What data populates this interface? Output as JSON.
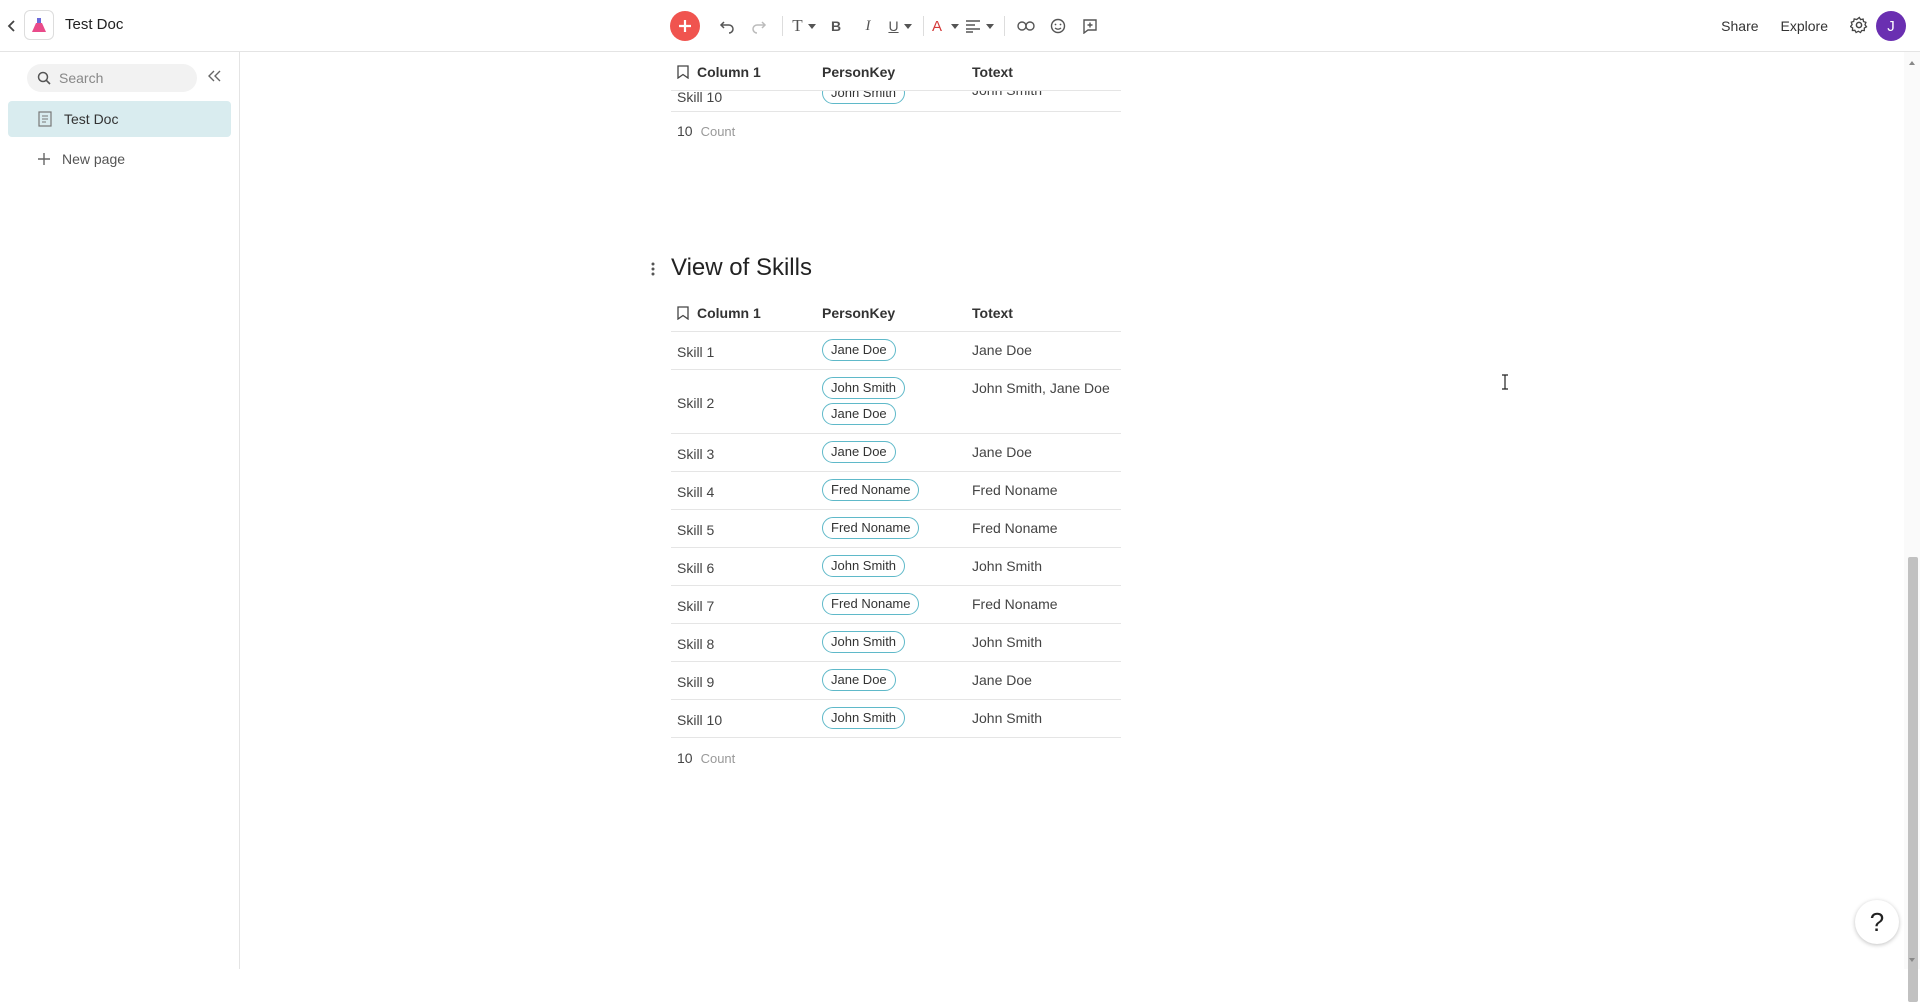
{
  "app": {
    "doc_title": "Test Doc",
    "toolbar": {
      "text_style_label": "T",
      "bold_label": "B",
      "italic_label": "I",
      "underline_label": "U",
      "text_color_label": "A"
    },
    "share_label": "Share",
    "explore_label": "Explore",
    "avatar_initial": "J",
    "help_label": "?"
  },
  "sidebar": {
    "search_placeholder": "Search",
    "pages": [
      {
        "label": "Test Doc"
      }
    ],
    "new_page_label": "New page"
  },
  "top_table": {
    "headers": [
      "Column 1",
      "PersonKey",
      "Totext"
    ],
    "partial_row": {
      "column1": "Skill 10",
      "person": "John Smith",
      "totext": "John Smith"
    },
    "footer_count": "10",
    "footer_label": "Count"
  },
  "skills_view": {
    "title": "View of Skills",
    "headers": [
      "Column 1",
      "PersonKey",
      "Totext"
    ],
    "rows": [
      {
        "column1": "Skill 1",
        "persons": [
          "Jane Doe"
        ],
        "totext": "Jane Doe"
      },
      {
        "column1": "Skill 2",
        "persons": [
          "John Smith",
          "Jane Doe"
        ],
        "totext": "John Smith, Jane Doe"
      },
      {
        "column1": "Skill 3",
        "persons": [
          "Jane Doe"
        ],
        "totext": "Jane Doe"
      },
      {
        "column1": "Skill 4",
        "persons": [
          "Fred Noname"
        ],
        "totext": "Fred Noname"
      },
      {
        "column1": "Skill 5",
        "persons": [
          "Fred Noname"
        ],
        "totext": "Fred Noname"
      },
      {
        "column1": "Skill 6",
        "persons": [
          "John Smith"
        ],
        "totext": "John Smith"
      },
      {
        "column1": "Skill 7",
        "persons": [
          "Fred Noname"
        ],
        "totext": "Fred Noname"
      },
      {
        "column1": "Skill 8",
        "persons": [
          "John Smith"
        ],
        "totext": "John Smith"
      },
      {
        "column1": "Skill 9",
        "persons": [
          "Jane Doe"
        ],
        "totext": "Jane Doe"
      },
      {
        "column1": "Skill 10",
        "persons": [
          "John Smith"
        ],
        "totext": "John Smith"
      }
    ],
    "footer_count": "10",
    "footer_label": "Count"
  },
  "colors": {
    "accent_add": "#f0544f",
    "selected_page_bg": "#d9ecef",
    "chip_border": "#5fb9c9",
    "avatar_bg": "#6a2fb1"
  }
}
